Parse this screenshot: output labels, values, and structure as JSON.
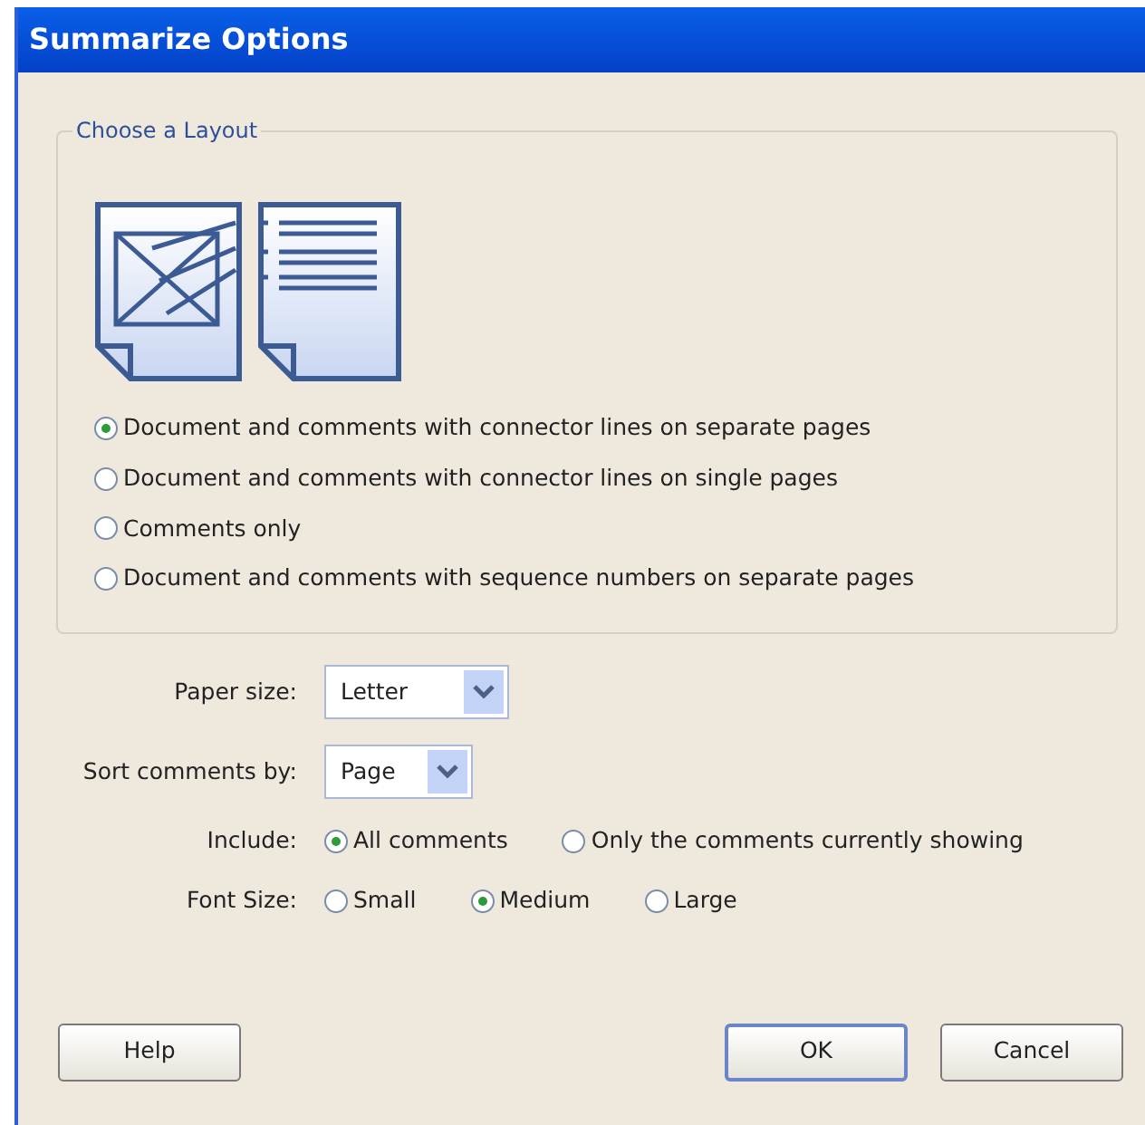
{
  "window": {
    "title": "Summarize Options"
  },
  "layout_group": {
    "title": "Choose a Layout",
    "options": [
      {
        "label": "Document and comments with connector lines on separate pages",
        "selected": true
      },
      {
        "label": "Document and comments with connector lines on single pages",
        "selected": false
      },
      {
        "label": "Comments only",
        "selected": false
      },
      {
        "label": "Document and comments with sequence numbers on separate pages",
        "selected": false
      }
    ]
  },
  "paper_size": {
    "label": "Paper size:",
    "value": "Letter"
  },
  "sort_by": {
    "label": "Sort comments by:",
    "value": "Page"
  },
  "include": {
    "label": "Include:",
    "options": [
      {
        "label": "All comments",
        "selected": true
      },
      {
        "label": "Only the comments currently showing",
        "selected": false
      }
    ]
  },
  "font_size": {
    "label": "Font Size:",
    "options": [
      {
        "label": "Small",
        "selected": false
      },
      {
        "label": "Medium",
        "selected": true
      },
      {
        "label": "Large",
        "selected": false
      }
    ]
  },
  "buttons": [
    {
      "label": "Help",
      "default": false
    },
    {
      "label": "OK",
      "default": true
    },
    {
      "label": "Cancel",
      "default": false
    }
  ]
}
